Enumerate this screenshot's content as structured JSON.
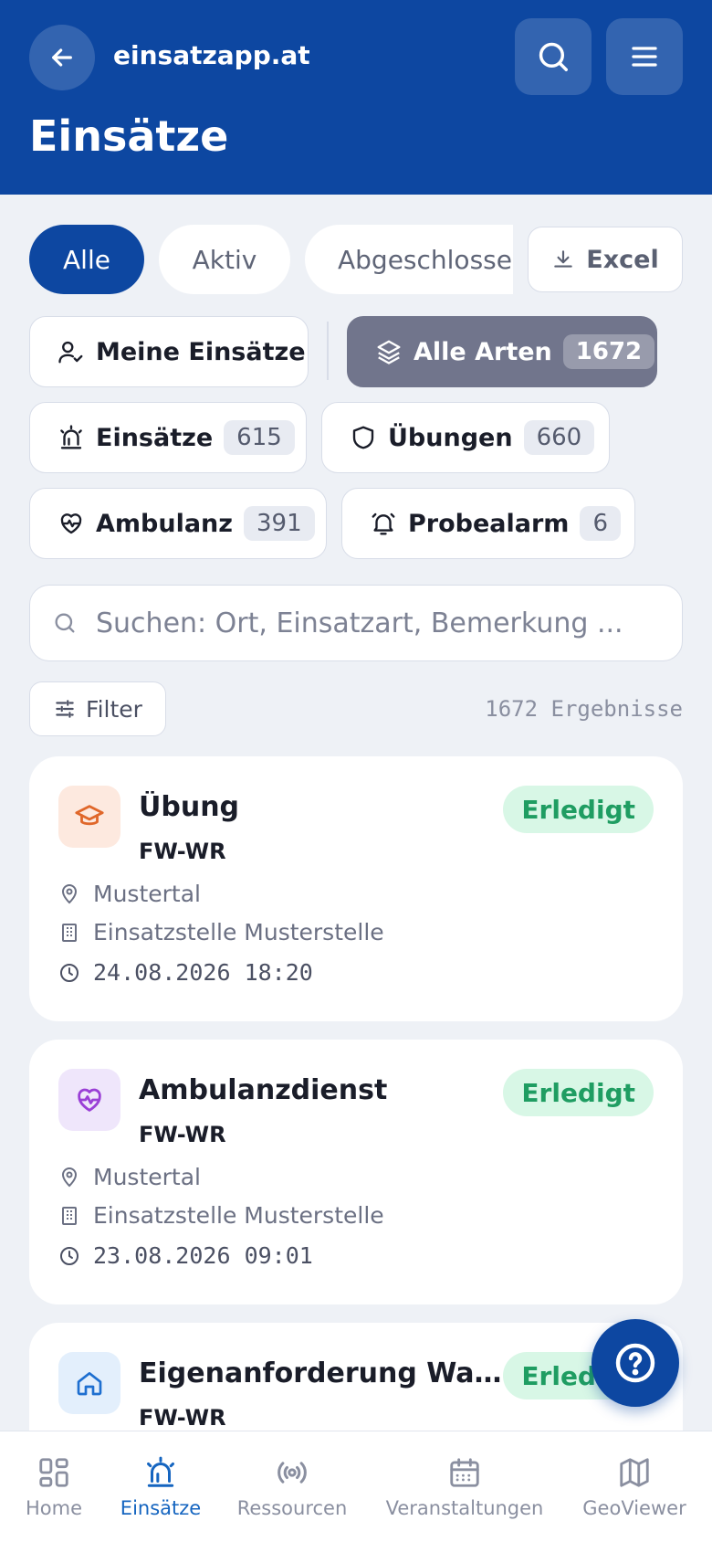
{
  "header": {
    "site_name": "einsatzapp.at",
    "page_title": "Einsätze"
  },
  "segments": [
    {
      "label": "Alle",
      "active": true
    },
    {
      "label": "Aktiv",
      "active": false
    },
    {
      "label": "Abgeschlossen",
      "active": false
    }
  ],
  "excel_label": "Excel",
  "chips": {
    "mine": {
      "label": "Meine Einsätze"
    },
    "all_types": {
      "label": "Alle Arten",
      "count": "1672"
    },
    "einsaetze": {
      "label": "Einsätze",
      "count": "615"
    },
    "uebungen": {
      "label": "Übungen",
      "count": "660"
    },
    "ambulanz": {
      "label": "Ambulanz",
      "count": "391"
    },
    "probealarm": {
      "label": "Probealarm",
      "count": "6"
    }
  },
  "search": {
    "placeholder": "Suchen: Ort, Einsatzart, Bemerkung ..."
  },
  "filter_label": "Filter",
  "result_count": "1672 Ergebnisse",
  "cards": [
    {
      "title": "Übung",
      "org": "FW-WR",
      "status": "Erledigt",
      "location": "Mustertal",
      "station": "Einsatzstelle Musterstelle",
      "datetime": "24.08.2026 18:20",
      "icon": "graduation-cap-icon"
    },
    {
      "title": "Ambulanzdienst",
      "org": "FW-WR",
      "status": "Erledigt",
      "location": "Mustertal",
      "station": "Einsatzstelle Musterstelle",
      "datetime": "23.08.2026 09:01",
      "icon": "heart-pulse-icon"
    },
    {
      "title": "Eigenanforderung Wasserversorgung",
      "org": "FW-WR",
      "status": "Erledigt",
      "icon": "home-icon"
    }
  ],
  "nav": [
    {
      "label": "Home"
    },
    {
      "label": "Einsätze",
      "active": true
    },
    {
      "label": "Ressourcen"
    },
    {
      "label": "Veranstaltungen"
    },
    {
      "label": "GeoViewer"
    }
  ],
  "colors": {
    "primary": "#0d47a1",
    "active_nav": "#1565c0",
    "success": "#1f9d62"
  }
}
